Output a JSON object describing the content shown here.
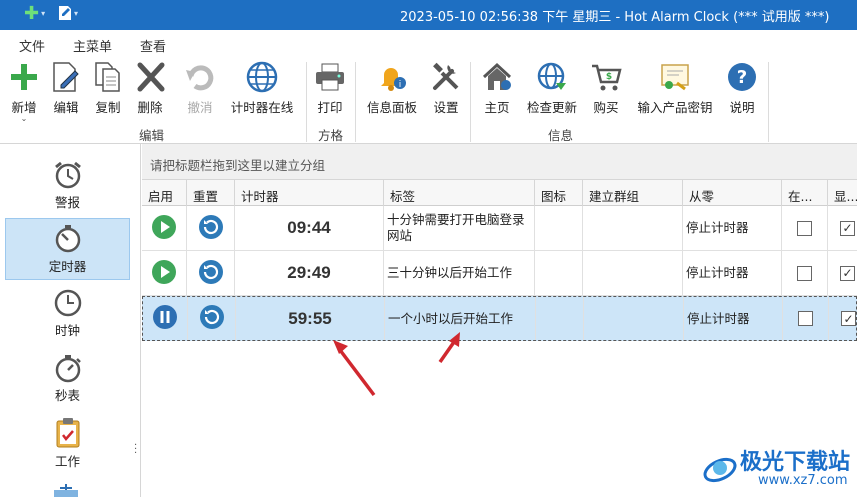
{
  "titlebar": {
    "title": "2023-05-10 02:56:38 下午 星期三 - Hot Alarm Clock (*** 试用版 ***)"
  },
  "menu": {
    "tabs": [
      "文件",
      "主菜单",
      "查看"
    ],
    "active": "主菜单"
  },
  "ribbon": {
    "buttons": [
      {
        "label": "新增",
        "icon": "plus-icon"
      },
      {
        "label": "编辑",
        "icon": "edit-icon"
      },
      {
        "label": "复制",
        "icon": "copy-icon"
      },
      {
        "label": "删除",
        "icon": "delete-icon"
      },
      {
        "label": "撤消",
        "icon": "undo-icon",
        "disabled": true
      },
      {
        "label": "计时器在线",
        "icon": "globe-icon"
      },
      {
        "label": "打印",
        "icon": "printer-icon"
      },
      {
        "label": "信息面板",
        "icon": "bell-icon"
      },
      {
        "label": "设置",
        "icon": "tools-icon"
      },
      {
        "label": "主页",
        "icon": "home-icon"
      },
      {
        "label": "检查更新",
        "icon": "globe-update-icon"
      },
      {
        "label": "购买",
        "icon": "cart-icon"
      },
      {
        "label": "输入产品密钥",
        "icon": "certificate-icon"
      },
      {
        "label": "说明",
        "icon": "help-icon"
      }
    ],
    "groups": [
      "编辑",
      "方格",
      "信息"
    ]
  },
  "sidebar": {
    "items": [
      {
        "label": "警报",
        "icon": "alarm-clock-icon"
      },
      {
        "label": "定时器",
        "icon": "timer-icon",
        "active": true
      },
      {
        "label": "时钟",
        "icon": "clock-icon"
      },
      {
        "label": "秒表",
        "icon": "stopwatch-icon"
      },
      {
        "label": "工作",
        "icon": "clipboard-icon"
      }
    ]
  },
  "grouppanel": {
    "hint": "请把标题栏拖到这里以建立分组"
  },
  "grid": {
    "columns": [
      "启用",
      "重置",
      "计时器",
      "标签",
      "图标",
      "建立群组",
      "从零",
      "在...",
      "显..."
    ],
    "rows": [
      {
        "state": "play",
        "timer": "09:44",
        "label": "十分钟需要打开电脑登录网站",
        "from_zero": "停止计时器",
        "col8": false,
        "col9": true,
        "selected": false
      },
      {
        "state": "play",
        "timer": "29:49",
        "label": "三十分钟以后开始工作",
        "from_zero": "停止计时器",
        "col8": false,
        "col9": true,
        "selected": false
      },
      {
        "state": "pause",
        "timer": "59:55",
        "label": "一个小时以后开始工作",
        "from_zero": "停止计时器",
        "col8": false,
        "col9": true,
        "selected": true
      }
    ]
  },
  "watermark": {
    "brand": "极光下载站",
    "url": "www.xz7.com"
  },
  "colors": {
    "accent": "#1e6fc2",
    "play": "#3fa65a",
    "reset": "#2d7ab8",
    "selection": "#cde5f8",
    "arrow": "#d0282f"
  }
}
